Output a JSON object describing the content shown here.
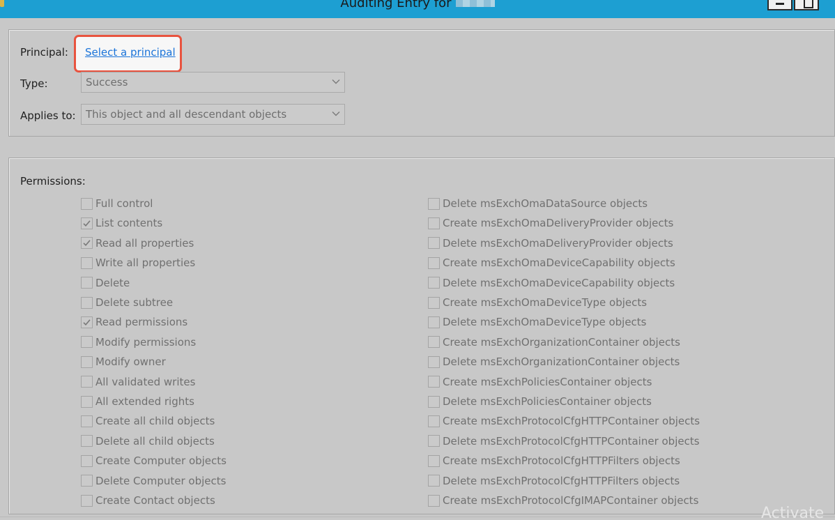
{
  "window": {
    "title": "Auditing Entry for",
    "minimize_icon": "minimize-icon",
    "maximize_icon": "maximize-icon"
  },
  "principal": {
    "label": "Principal:",
    "link": "Select a principal"
  },
  "type": {
    "label": "Type:",
    "value": "Success"
  },
  "applies_to": {
    "label": "Applies to:",
    "value": "This object and all descendant objects"
  },
  "permissions": {
    "label": "Permissions:",
    "left": [
      {
        "label": "Full control",
        "checked": false
      },
      {
        "label": "List contents",
        "checked": true
      },
      {
        "label": "Read all properties",
        "checked": true
      },
      {
        "label": "Write all properties",
        "checked": false
      },
      {
        "label": "Delete",
        "checked": false
      },
      {
        "label": "Delete subtree",
        "checked": false
      },
      {
        "label": "Read permissions",
        "checked": true
      },
      {
        "label": "Modify permissions",
        "checked": false
      },
      {
        "label": "Modify owner",
        "checked": false
      },
      {
        "label": "All validated writes",
        "checked": false
      },
      {
        "label": "All extended rights",
        "checked": false
      },
      {
        "label": "Create all child objects",
        "checked": false
      },
      {
        "label": "Delete all child objects",
        "checked": false
      },
      {
        "label": "Create Computer objects",
        "checked": false
      },
      {
        "label": "Delete Computer objects",
        "checked": false
      },
      {
        "label": "Create Contact objects",
        "checked": false
      }
    ],
    "right": [
      {
        "label": "Delete msExchOmaDataSource objects",
        "checked": false
      },
      {
        "label": "Create msExchOmaDeliveryProvider objects",
        "checked": false
      },
      {
        "label": "Delete msExchOmaDeliveryProvider objects",
        "checked": false
      },
      {
        "label": "Create msExchOmaDeviceCapability objects",
        "checked": false
      },
      {
        "label": "Delete msExchOmaDeviceCapability objects",
        "checked": false
      },
      {
        "label": "Create msExchOmaDeviceType objects",
        "checked": false
      },
      {
        "label": "Delete msExchOmaDeviceType objects",
        "checked": false
      },
      {
        "label": "Create msExchOrganizationContainer objects",
        "checked": false
      },
      {
        "label": "Delete msExchOrganizationContainer objects",
        "checked": false
      },
      {
        "label": "Create msExchPoliciesContainer objects",
        "checked": false
      },
      {
        "label": "Delete msExchPoliciesContainer objects",
        "checked": false
      },
      {
        "label": "Create msExchProtocolCfgHTTPContainer objects",
        "checked": false
      },
      {
        "label": "Delete msExchProtocolCfgHTTPContainer objects",
        "checked": false
      },
      {
        "label": "Create msExchProtocolCfgHTTPFilters objects",
        "checked": false
      },
      {
        "label": "Delete msExchProtocolCfgHTTPFilters objects",
        "checked": false
      },
      {
        "label": "Create msExchProtocolCfgIMAPContainer objects",
        "checked": false
      }
    ]
  },
  "watermark": "Activate",
  "colors": {
    "titlebar": "#1d9fd2",
    "link": "#1a73d9",
    "highlight": "#e8533f",
    "background": "#c8c8c8"
  }
}
